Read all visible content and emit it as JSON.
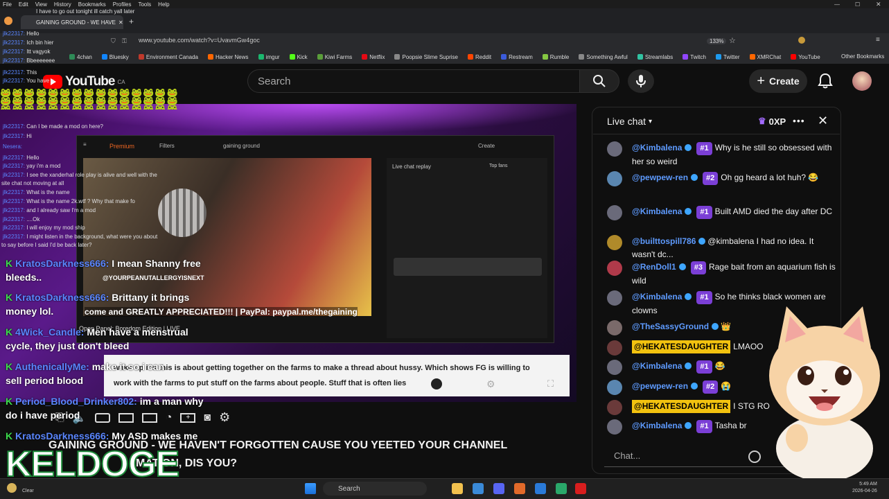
{
  "browser": {
    "menu": [
      "File",
      "Edit",
      "View",
      "History",
      "Bookmarks",
      "Profiles",
      "Tools",
      "Help"
    ],
    "tab_title": "GAINING GROUND - WE HAVE",
    "url": "www.youtube.com/watch?v=UvavmGw4goc",
    "zoom": "133%",
    "bookmarks": [
      {
        "label": "4chan",
        "color": "#2e8b57"
      },
      {
        "label": "Bluesky",
        "color": "#1185fe"
      },
      {
        "label": "Environment Canada",
        "color": "#c0392b"
      },
      {
        "label": "Hacker News",
        "color": "#ff6600"
      },
      {
        "label": "imgur",
        "color": "#1bb76e"
      },
      {
        "label": "Kick",
        "color": "#53fc18"
      },
      {
        "label": "Kiwi Farms",
        "color": "#5a9e3a"
      },
      {
        "label": "Netflix",
        "color": "#e50914"
      },
      {
        "label": "Poopsie Slime Suprise",
        "color": "#888888"
      },
      {
        "label": "Reddit",
        "color": "#ff4500"
      },
      {
        "label": "Restream",
        "color": "#3b5bdb"
      },
      {
        "label": "Rumble",
        "color": "#85c742"
      },
      {
        "label": "Something Awful",
        "color": "#888888"
      },
      {
        "label": "Streamlabs",
        "color": "#31c3a2"
      },
      {
        "label": "Twitch",
        "color": "#9146ff"
      },
      {
        "label": "Twitter",
        "color": "#1d9bf0"
      },
      {
        "label": "XMRChat",
        "color": "#ff6600"
      },
      {
        "label": "YouTube",
        "color": "#ff0000"
      }
    ],
    "other_bookmarks": "Other Bookmarks"
  },
  "youtube": {
    "logo_text": "YouTube",
    "logo_region": "CA",
    "search_placeholder": "Search",
    "create_label": "Create"
  },
  "video": {
    "title_line1": "GAINING GROUND - WE HAVEN'T FORGOTTEN CAUSE YOU YEETED YOUR CHANNEL",
    "title_line2": "MATION, DIS YOU?",
    "subtitle_line1": "wake up it's this is about getting together on the farms to make a thread about hussy. Which shows FG is willing to",
    "subtitle_line2": "work with the farms to put stuff on the farms about people. Stuff that is often lies",
    "inner_search": "gaining ground",
    "inner_premium": "Premium",
    "inner_filters": "Filters",
    "inner_create": "Create",
    "inner_chat_label": "Live chat replay",
    "inner_top_fans": "Top fans",
    "inner_banner_top": "@YOURPEANUTALLERGYISNEXT",
    "inner_banner_bottom": "come and GREATLY APPRECIATED!!! | PayPal: paypal.me/thegaining",
    "inner_caption": "Open Panel: Boredom Edition | LIVE",
    "keldoge": "KELDOGE"
  },
  "overlay_chat": {
    "top_line": "I have to go out tonight ill catch yall later",
    "small_lines": [
      {
        "user": "jlk22317:",
        "text": "Hello"
      },
      {
        "user": "jlk22317:",
        "text": "Ich bin hier"
      },
      {
        "user": "jlk22317:",
        "text": "Itt vagyok"
      },
      {
        "user": "jlk22317:",
        "text": "Bbeeeeeee"
      },
      {
        "user": "jlk22317:",
        "text": "This"
      },
      {
        "user": "jlk22317:",
        "text": "You have a"
      },
      {
        "user": "jlk22317:",
        "text": "Can I be made a mod on here?"
      },
      {
        "user": "Nesera:",
        "text": ""
      },
      {
        "user": "jlk22317:",
        "text": "Hi"
      },
      {
        "user": "jlk22317:",
        "text": "Hello"
      },
      {
        "user": "jlk22317:",
        "text": "yay i'm a mod"
      },
      {
        "user": "jlk22317:",
        "text": "I see the xanderhal role play is alive and well with the"
      },
      {
        "user": "",
        "text": "site chat not moving at all"
      },
      {
        "user": "jlk22317:",
        "text": "What is the name"
      },
      {
        "user": "jlk22317:",
        "text": "What is the name 2k.wtf ? Why that make fo"
      },
      {
        "user": "jlk22317:",
        "text": "and I already saw I'm a mod"
      },
      {
        "user": "jlk22317:",
        "text": "....Ok"
      },
      {
        "user": "jlk22317:",
        "text": "I will enjoy my mod ship"
      },
      {
        "user": "jlk22317:",
        "text": "I might listen in the background, what were you about"
      },
      {
        "user": "",
        "text": "to say before I said I'd be back later?"
      }
    ],
    "big_lines": [
      {
        "user": "KratosDarkness666:",
        "text": "I mean Shanny free",
        "cont": "bleeds.."
      },
      {
        "user": "KratosDarkness666:",
        "text": "Brittany it brings",
        "cont": "money lol."
      },
      {
        "user": "4Wick_Candle:",
        "text": "Men have a menstrual",
        "cont": "cycle, they just don't bleed"
      },
      {
        "user": "AuthenicallyMe:",
        "text": "make it so i can",
        "cont": "sell period blood"
      },
      {
        "user": "Period_Blood_Drinker802:",
        "text": "im a man why",
        "cont": "do i have period"
      },
      {
        "user": "KratosDarkness666:",
        "text": "My ASD makes me",
        "cont": ""
      }
    ]
  },
  "live_chat": {
    "title": "Live chat",
    "xp": "0XP",
    "input_placeholder": "Chat...",
    "messages": [
      {
        "user": "@Kimbalena",
        "rank": "#1",
        "text": "Why is he still so obsessed with her so weird",
        "avatar": "#6a6a7a"
      },
      {
        "user": "@pewpew-ren",
        "rank": "#2",
        "text": "Oh gg heard a lot huh? 😂",
        "avatar": "#5a86b0"
      },
      {
        "user": "@Kimbalena",
        "rank": "#1",
        "text": "Built AMD died the day after DC",
        "avatar": "#6a6a7a"
      },
      {
        "user": "@builttospill786",
        "rank": "",
        "text": "@kimbalena I had no idea. It wasn't dc...",
        "avatar": "#b08a2a"
      },
      {
        "user": "@RenDoll1",
        "rank": "#3",
        "text": "Rage bait from an aquarium fish is wild",
        "avatar": "#b03a4a"
      },
      {
        "user": "@Kimbalena",
        "rank": "#1",
        "text": "So he thinks black women are clowns",
        "avatar": "#6a6a7a"
      },
      {
        "user": "@TheSassyGround",
        "rank": "",
        "text": "👑",
        "avatar": "#7a6a6a"
      },
      {
        "user": "@HEKATESDAUGHTER",
        "rank": "",
        "text": "LMAOO",
        "avatar": "#6a3a3a",
        "highlight": true
      },
      {
        "user": "@Kimbalena",
        "rank": "#1",
        "text": "😂",
        "avatar": "#6a6a7a"
      },
      {
        "user": "@pewpew-ren",
        "rank": "#2",
        "text": "😭",
        "avatar": "#5a86b0"
      },
      {
        "user": "@HEKATESDAUGHTER",
        "rank": "",
        "text": "I STG RO",
        "avatar": "#6a3a3a",
        "highlight": true
      },
      {
        "user": "@Kimbalena",
        "rank": "#1",
        "text": "Tasha br",
        "avatar": "#6a6a7a"
      }
    ]
  },
  "taskbar": {
    "search": "Search",
    "weather": "Clear",
    "time": "5:49 AM",
    "date": "2026-04-26"
  }
}
